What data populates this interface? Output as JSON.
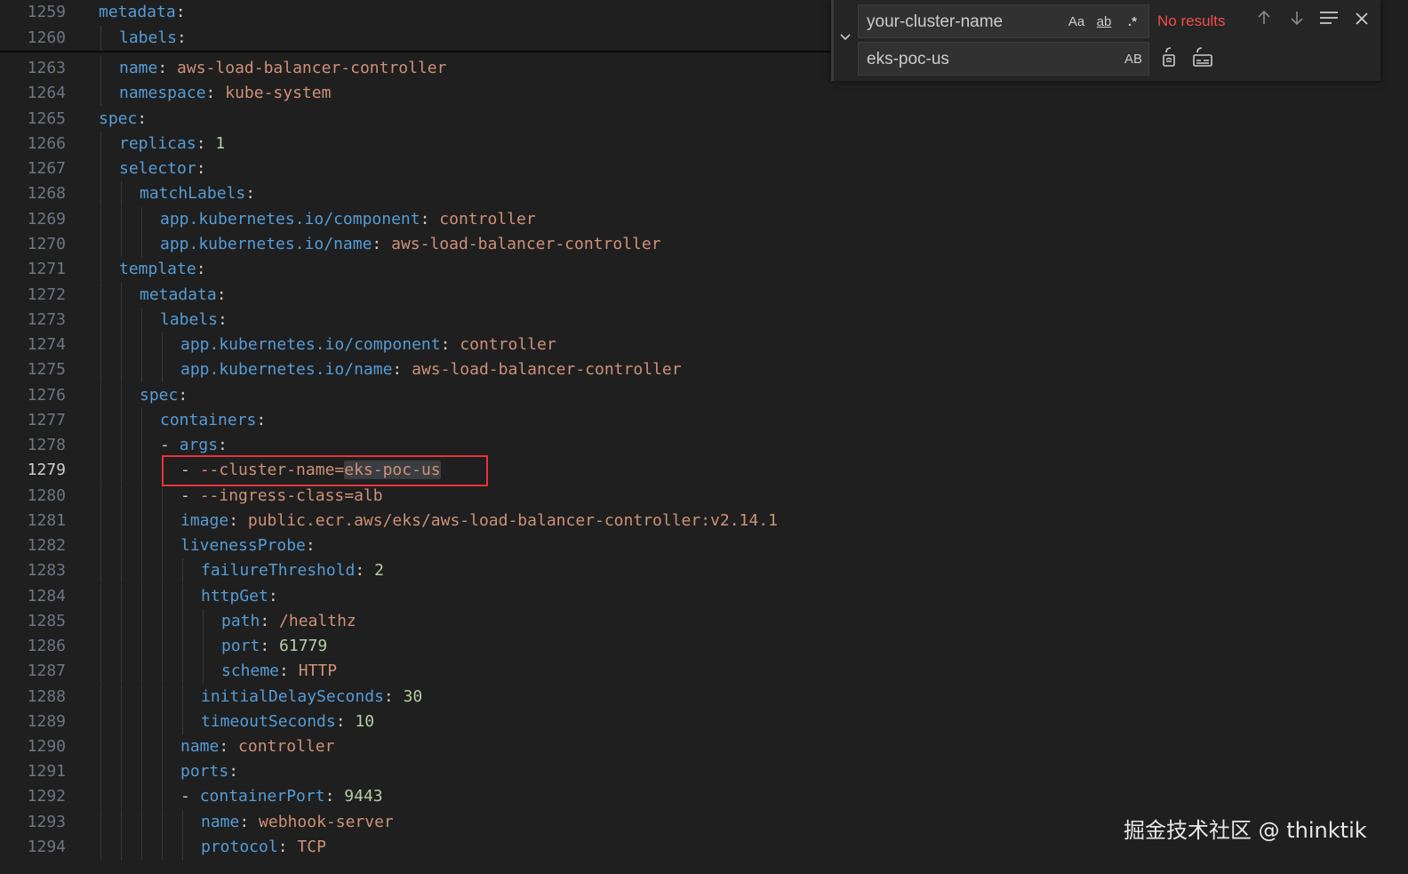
{
  "find": {
    "search_value": "your-cluster-name",
    "match_case_label": "Aa",
    "whole_word_label": "ab",
    "regex_label": ".*",
    "status": "No results",
    "replace_value": "eks-poc-us",
    "preserve_case_label": "AB",
    "icons": [
      "chevron-down-icon",
      "arrow-up-icon",
      "arrow-down-icon",
      "find-in-selection-icon",
      "close-icon",
      "replace-icon",
      "replace-all-icon"
    ]
  },
  "editor": {
    "current_line": "1279",
    "lines": [
      {
        "n": "1259",
        "tokens": [
          [
            "k",
            "metadata"
          ],
          [
            "p",
            ":"
          ]
        ]
      },
      {
        "n": "1260",
        "tokens": [
          [
            "k",
            "labels"
          ],
          [
            "p",
            ":"
          ]
        ]
      },
      {
        "n": "1263",
        "tokens": [
          [
            "k",
            "name"
          ],
          [
            "p",
            ": "
          ],
          [
            "v",
            "aws-load-balancer-controller"
          ]
        ]
      },
      {
        "n": "1264",
        "tokens": [
          [
            "k",
            "namespace"
          ],
          [
            "p",
            ": "
          ],
          [
            "v",
            "kube-system"
          ]
        ]
      },
      {
        "n": "1265",
        "tokens": [
          [
            "k",
            "spec"
          ],
          [
            "p",
            ":"
          ]
        ]
      },
      {
        "n": "1266",
        "tokens": [
          [
            "k",
            "replicas"
          ],
          [
            "p",
            ": "
          ],
          [
            "n",
            "1"
          ]
        ]
      },
      {
        "n": "1267",
        "tokens": [
          [
            "k",
            "selector"
          ],
          [
            "p",
            ":"
          ]
        ]
      },
      {
        "n": "1268",
        "tokens": [
          [
            "k",
            "matchLabels"
          ],
          [
            "p",
            ":"
          ]
        ]
      },
      {
        "n": "1269",
        "tokens": [
          [
            "k",
            "app.kubernetes.io/component"
          ],
          [
            "p",
            ": "
          ],
          [
            "v",
            "controller"
          ]
        ]
      },
      {
        "n": "1270",
        "tokens": [
          [
            "k",
            "app.kubernetes.io/name"
          ],
          [
            "p",
            ": "
          ],
          [
            "v",
            "aws-load-balancer-controller"
          ]
        ]
      },
      {
        "n": "1271",
        "tokens": [
          [
            "k",
            "template"
          ],
          [
            "p",
            ":"
          ]
        ]
      },
      {
        "n": "1272",
        "tokens": [
          [
            "k",
            "metadata"
          ],
          [
            "p",
            ":"
          ]
        ]
      },
      {
        "n": "1273",
        "tokens": [
          [
            "k",
            "labels"
          ],
          [
            "p",
            ":"
          ]
        ]
      },
      {
        "n": "1274",
        "tokens": [
          [
            "k",
            "app.kubernetes.io/component"
          ],
          [
            "p",
            ": "
          ],
          [
            "v",
            "controller"
          ]
        ]
      },
      {
        "n": "1275",
        "tokens": [
          [
            "k",
            "app.kubernetes.io/name"
          ],
          [
            "p",
            ": "
          ],
          [
            "v",
            "aws-load-balancer-controller"
          ]
        ]
      },
      {
        "n": "1276",
        "tokens": [
          [
            "k",
            "spec"
          ],
          [
            "p",
            ":"
          ]
        ]
      },
      {
        "n": "1277",
        "tokens": [
          [
            "k",
            "containers"
          ],
          [
            "p",
            ":"
          ]
        ]
      },
      {
        "n": "1278",
        "tokens": [
          [
            "m",
            "- "
          ],
          [
            "k",
            "args"
          ],
          [
            "p",
            ":"
          ]
        ]
      },
      {
        "n": "1279",
        "tokens": [
          [
            "m",
            "- "
          ],
          [
            "v",
            "--cluster-name="
          ],
          [
            "vh",
            "eks-poc-us"
          ]
        ]
      },
      {
        "n": "1280",
        "tokens": [
          [
            "m",
            "- "
          ],
          [
            "v",
            "--ingress-class=alb"
          ]
        ]
      },
      {
        "n": "1281",
        "tokens": [
          [
            "k",
            "image"
          ],
          [
            "p",
            ": "
          ],
          [
            "v",
            "public.ecr.aws/eks/aws-load-balancer-controller:v2.14.1"
          ]
        ]
      },
      {
        "n": "1282",
        "tokens": [
          [
            "k",
            "livenessProbe"
          ],
          [
            "p",
            ":"
          ]
        ]
      },
      {
        "n": "1283",
        "tokens": [
          [
            "k",
            "failureThreshold"
          ],
          [
            "p",
            ": "
          ],
          [
            "n",
            "2"
          ]
        ]
      },
      {
        "n": "1284",
        "tokens": [
          [
            "k",
            "httpGet"
          ],
          [
            "p",
            ":"
          ]
        ]
      },
      {
        "n": "1285",
        "tokens": [
          [
            "k",
            "path"
          ],
          [
            "p",
            ": "
          ],
          [
            "v",
            "/healthz"
          ]
        ]
      },
      {
        "n": "1286",
        "tokens": [
          [
            "k",
            "port"
          ],
          [
            "p",
            ": "
          ],
          [
            "n",
            "61779"
          ]
        ]
      },
      {
        "n": "1287",
        "tokens": [
          [
            "k",
            "scheme"
          ],
          [
            "p",
            ": "
          ],
          [
            "v",
            "HTTP"
          ]
        ]
      },
      {
        "n": "1288",
        "tokens": [
          [
            "k",
            "initialDelaySeconds"
          ],
          [
            "p",
            ": "
          ],
          [
            "n",
            "30"
          ]
        ]
      },
      {
        "n": "1289",
        "tokens": [
          [
            "k",
            "timeoutSeconds"
          ],
          [
            "p",
            ": "
          ],
          [
            "n",
            "10"
          ]
        ]
      },
      {
        "n": "1290",
        "tokens": [
          [
            "k",
            "name"
          ],
          [
            "p",
            ": "
          ],
          [
            "v",
            "controller"
          ]
        ]
      },
      {
        "n": "1291",
        "tokens": [
          [
            "k",
            "ports"
          ],
          [
            "p",
            ":"
          ]
        ]
      },
      {
        "n": "1292",
        "tokens": [
          [
            "m",
            "- "
          ],
          [
            "k",
            "containerPort"
          ],
          [
            "p",
            ": "
          ],
          [
            "n",
            "9443"
          ]
        ]
      },
      {
        "n": "1293",
        "tokens": [
          [
            "k",
            "name"
          ],
          [
            "p",
            ": "
          ],
          [
            "v",
            "webhook-server"
          ]
        ]
      },
      {
        "n": "1294",
        "tokens": [
          [
            "k",
            "protocol"
          ],
          [
            "p",
            ": "
          ],
          [
            "v",
            "TCP"
          ]
        ]
      }
    ]
  },
  "watermark": "掘金技术社区 @ thinktik"
}
